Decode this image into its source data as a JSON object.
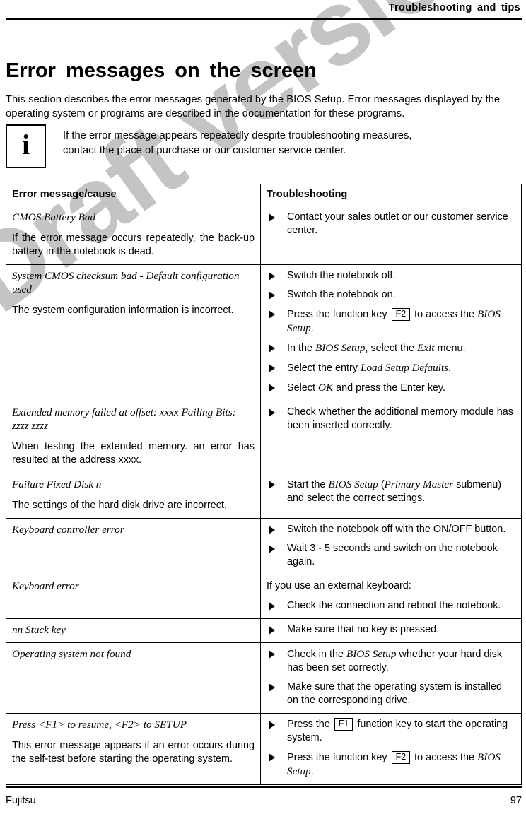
{
  "watermark": {
    "text": "Draft version"
  },
  "header": {
    "running_title": "Troubleshooting and tips"
  },
  "title": "Error messages on the screen",
  "intro": "This section describes the error messages generated by the BIOS Setup. Error messages displayed by the operating system or programs are described in the documentation for these programs.",
  "note": {
    "icon": "info-icon",
    "glyph": "i",
    "line1": "If the error message appears repeatedly despite troubleshooting measures,",
    "line2": "contact the place of purchase or our customer service center."
  },
  "table": {
    "headers": {
      "cause": "Error message/cause",
      "fix": "Troubleshooting"
    },
    "rows": [
      {
        "message": "CMOS Battery Bad",
        "description": "If the error message occurs repeatedly, the back-up battery in the notebook is dead.",
        "lead": "",
        "steps": [
          {
            "parts": [
              {
                "t": "Contact your sales outlet or our customer service center.",
                "s": "n"
              }
            ]
          }
        ]
      },
      {
        "message": "System CMOS checksum bad - Default configuration used",
        "description": "The system configuration information is incorrect.",
        "lead": "",
        "steps": [
          {
            "parts": [
              {
                "t": "Switch the notebook off.",
                "s": "n"
              }
            ]
          },
          {
            "parts": [
              {
                "t": "Switch the notebook on.",
                "s": "n"
              }
            ]
          },
          {
            "parts": [
              {
                "t": "Press the function key ",
                "s": "n"
              },
              {
                "t": "F2",
                "s": "k"
              },
              {
                "t": " to access the ",
                "s": "n"
              },
              {
                "t": "BIOS Setup",
                "s": "i"
              },
              {
                "t": ".",
                "s": "n"
              }
            ]
          },
          {
            "parts": [
              {
                "t": "In the ",
                "s": "n"
              },
              {
                "t": "BIOS Setup",
                "s": "i"
              },
              {
                "t": ", select the ",
                "s": "n"
              },
              {
                "t": "Exit",
                "s": "i"
              },
              {
                "t": " menu.",
                "s": "n"
              }
            ]
          },
          {
            "parts": [
              {
                "t": "Select the entry ",
                "s": "n"
              },
              {
                "t": "Load Setup Defaults",
                "s": "i"
              },
              {
                "t": ".",
                "s": "n"
              }
            ]
          },
          {
            "parts": [
              {
                "t": "Select ",
                "s": "n"
              },
              {
                "t": "OK",
                "s": "i"
              },
              {
                "t": " and press the Enter key.",
                "s": "n"
              }
            ]
          }
        ]
      },
      {
        "message": "Extended memory failed at offset: xxxx Failing Bits: zzzz zzzz",
        "description": "When testing the extended memory. an error has resulted at the address xxxx.",
        "lead": "",
        "steps": [
          {
            "parts": [
              {
                "t": "Check whether the additional memory module has been inserted correctly.",
                "s": "n"
              }
            ]
          }
        ]
      },
      {
        "message": "Failure Fixed Disk n",
        "description": "The settings of the hard disk drive are incorrect.",
        "lead": "",
        "steps": [
          {
            "parts": [
              {
                "t": "Start the ",
                "s": "n"
              },
              {
                "t": "BIOS Setup",
                "s": "i"
              },
              {
                "t": " (",
                "s": "n"
              },
              {
                "t": "Primary Master",
                "s": "i"
              },
              {
                "t": " submenu) and select the correct settings.",
                "s": "n"
              }
            ]
          }
        ]
      },
      {
        "message": "Keyboard controller error",
        "description": "",
        "lead": "",
        "steps": [
          {
            "parts": [
              {
                "t": "Switch the notebook off with the ON/OFF button.",
                "s": "n"
              }
            ]
          },
          {
            "parts": [
              {
                "t": "Wait 3 - 5 seconds and switch on the notebook again.",
                "s": "n"
              }
            ]
          }
        ]
      },
      {
        "message": "Keyboard error",
        "description": "",
        "lead": "If you use an external keyboard:",
        "steps": [
          {
            "parts": [
              {
                "t": "Check the connection and reboot the notebook.",
                "s": "n"
              }
            ]
          }
        ]
      },
      {
        "message": "nn Stuck key",
        "description": "",
        "lead": "",
        "steps": [
          {
            "parts": [
              {
                "t": "Make sure that no key is pressed.",
                "s": "n"
              }
            ]
          }
        ]
      },
      {
        "message": "Operating system not found",
        "description": "",
        "lead": "",
        "steps": [
          {
            "parts": [
              {
                "t": "Check in the ",
                "s": "n"
              },
              {
                "t": "BIOS Setup",
                "s": "i"
              },
              {
                "t": " whether your hard disk has been set correctly.",
                "s": "n"
              }
            ]
          },
          {
            "parts": [
              {
                "t": "Make sure that the operating system is installed on the corresponding drive.",
                "s": "n"
              }
            ]
          }
        ]
      },
      {
        "message": "Press <F1> to resume, <F2> to SETUP",
        "description": "This error message appears if an error occurs during the self-test before starting the operating system.",
        "lead": "",
        "steps": [
          {
            "parts": [
              {
                "t": "Press the ",
                "s": "n"
              },
              {
                "t": "F1",
                "s": "k"
              },
              {
                "t": " function key to start the operating system.",
                "s": "n"
              }
            ]
          },
          {
            "parts": [
              {
                "t": "Press the function key ",
                "s": "n"
              },
              {
                "t": "F2",
                "s": "k"
              },
              {
                "t": " to access the ",
                "s": "n"
              },
              {
                "t": "BIOS Setup",
                "s": "i"
              },
              {
                "t": ".",
                "s": "n"
              }
            ]
          }
        ]
      }
    ]
  },
  "footer": {
    "left": "Fujitsu",
    "page_number": "97"
  }
}
